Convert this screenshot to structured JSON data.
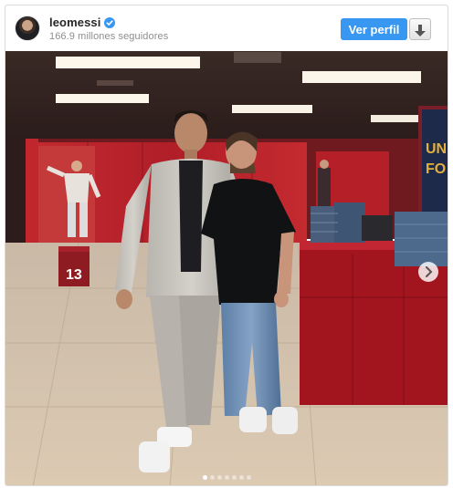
{
  "profile": {
    "username": "leomessi",
    "followers": "166.9 millones seguidores",
    "view_profile_label": "Ver perfil"
  },
  "icons": {
    "verified": "verified-badge-icon",
    "download": "download-arrow-icon",
    "next": "chevron-right-icon"
  },
  "photo": {
    "jersey_number": "13",
    "wall_text_lines": [
      "UNI",
      "FO"
    ]
  },
  "carousel": {
    "total": 7,
    "active_index": 0
  },
  "colors": {
    "accent": "#3897f0",
    "verified": "#3897f0",
    "locker_red": "#b8202b"
  }
}
